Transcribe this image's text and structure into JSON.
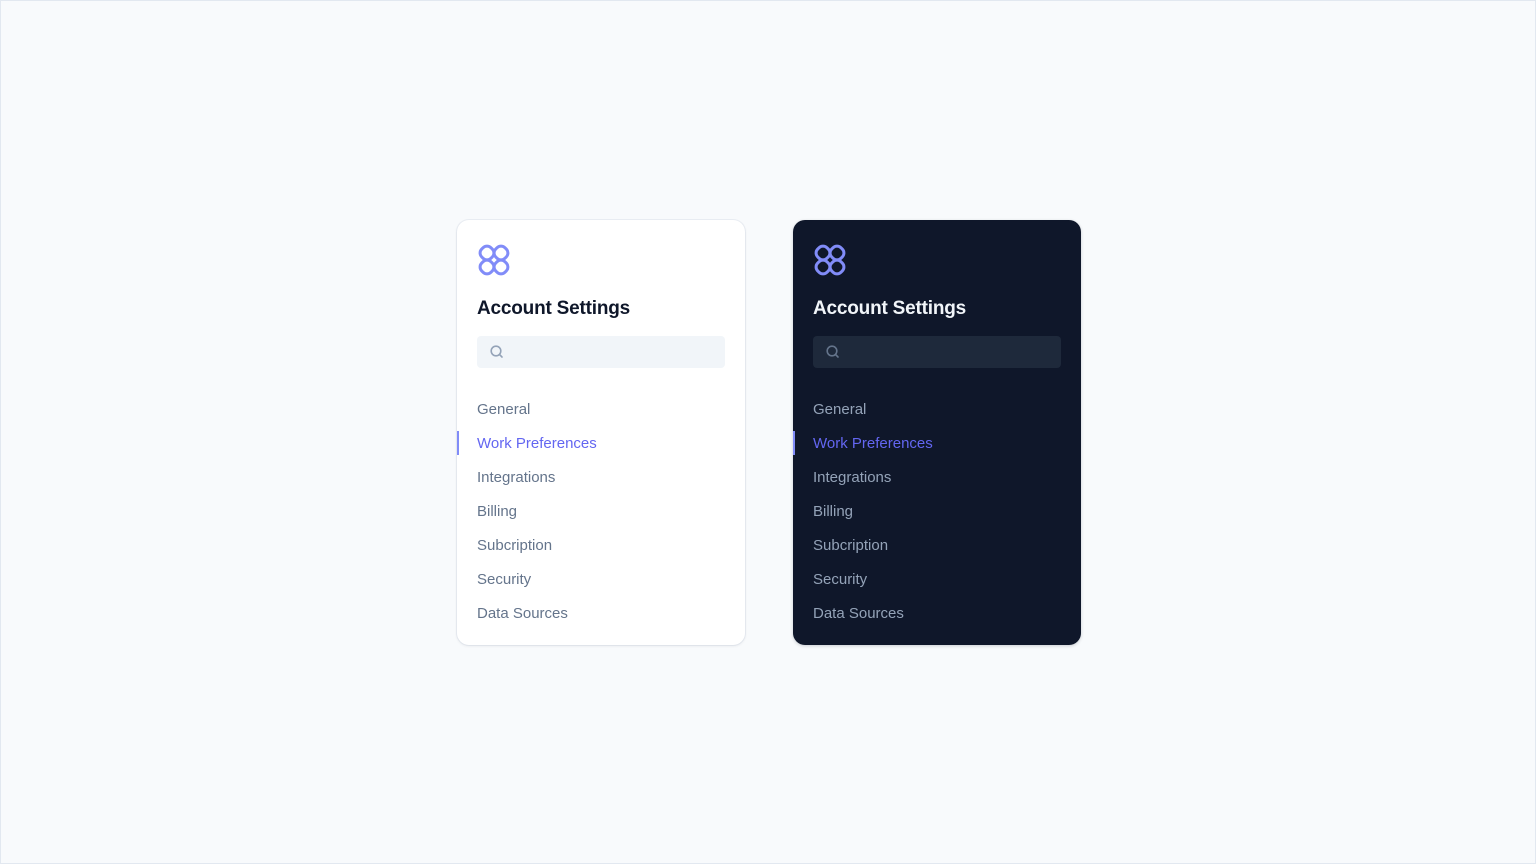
{
  "colors": {
    "accent": "#6366f1",
    "logo": "#818cf8",
    "page_background": "#f8fafc",
    "light_panel_background": "#ffffff",
    "dark_panel_background": "#0f172a"
  },
  "panels": [
    {
      "theme": "light",
      "logo_icon": "flower-logo-icon",
      "title": "Account Settings",
      "search": {
        "icon": "search-icon",
        "value": "",
        "placeholder": ""
      },
      "nav": {
        "active_index": 1,
        "items": [
          {
            "label": "General"
          },
          {
            "label": "Work Preferences"
          },
          {
            "label": "Integrations"
          },
          {
            "label": "Billing"
          },
          {
            "label": "Subcription"
          },
          {
            "label": "Security"
          },
          {
            "label": "Data Sources"
          }
        ]
      }
    },
    {
      "theme": "dark",
      "logo_icon": "flower-logo-icon",
      "title": "Account Settings",
      "search": {
        "icon": "search-icon",
        "value": "",
        "placeholder": ""
      },
      "nav": {
        "active_index": 1,
        "items": [
          {
            "label": "General"
          },
          {
            "label": "Work Preferences"
          },
          {
            "label": "Integrations"
          },
          {
            "label": "Billing"
          },
          {
            "label": "Subcription"
          },
          {
            "label": "Security"
          },
          {
            "label": "Data Sources"
          }
        ]
      }
    }
  ]
}
